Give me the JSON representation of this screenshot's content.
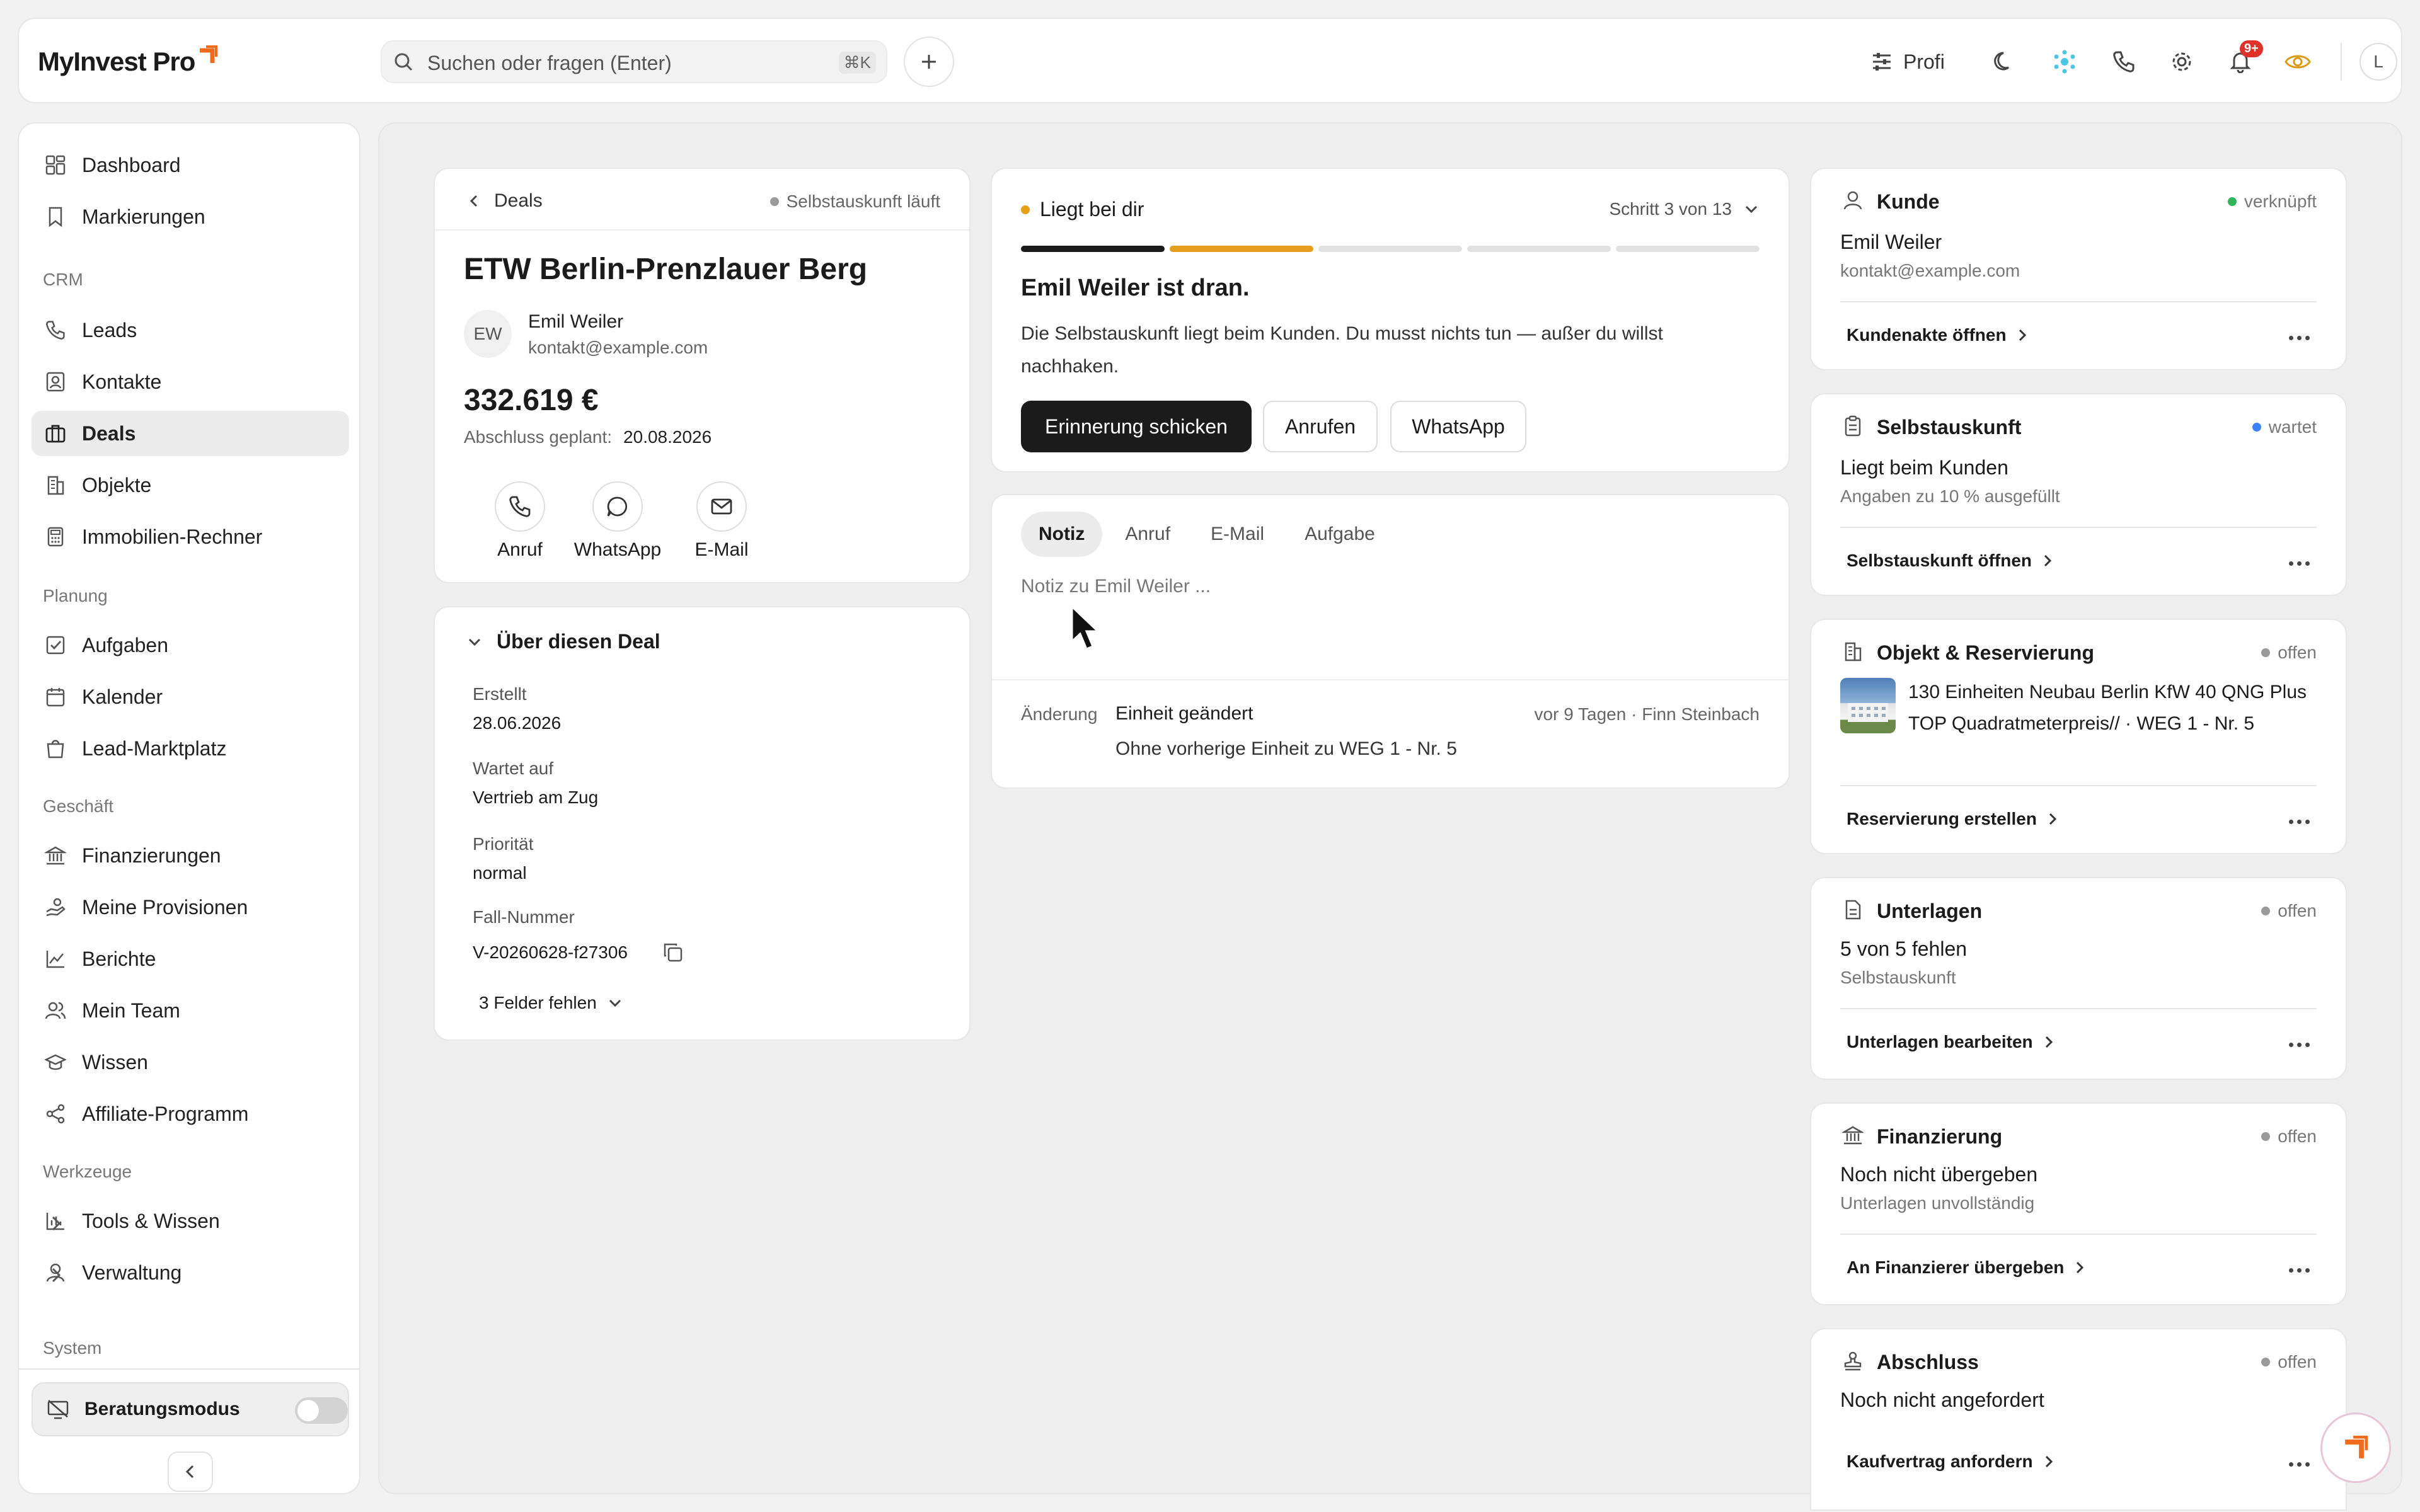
{
  "app": {
    "logo": "MyInvest Pro"
  },
  "search": {
    "placeholder": "Suchen oder fragen (Enter)",
    "shortcut": "⌘K"
  },
  "topbar": {
    "mode_label": "Profi",
    "notification_badge": "9+",
    "avatar_initial": "L"
  },
  "sidebar": {
    "items_main": [
      {
        "label": "Dashboard"
      },
      {
        "label": "Markierungen"
      }
    ],
    "section_crm": "CRM",
    "items_crm": [
      {
        "label": "Leads"
      },
      {
        "label": "Kontakte"
      },
      {
        "label": "Deals"
      },
      {
        "label": "Objekte"
      },
      {
        "label": "Immobilien-Rechner"
      }
    ],
    "section_planung": "Planung",
    "items_planung": [
      {
        "label": "Aufgaben"
      },
      {
        "label": "Kalender"
      },
      {
        "label": "Lead-Marktplatz"
      }
    ],
    "section_geschaeft": "Geschäft",
    "items_geschaeft": [
      {
        "label": "Finanzierungen"
      },
      {
        "label": "Meine Provisionen"
      },
      {
        "label": "Berichte"
      },
      {
        "label": "Mein Team"
      },
      {
        "label": "Wissen"
      },
      {
        "label": "Affiliate-Programm"
      }
    ],
    "section_werkzeuge": "Werkzeuge",
    "items_werkzeuge": [
      {
        "label": "Tools & Wissen"
      },
      {
        "label": "Verwaltung"
      }
    ],
    "section_system": "System",
    "beratungsmodus": "Beratungsmodus"
  },
  "deal": {
    "back_label": "Deals",
    "status": "Selbstauskunft läuft",
    "title": "ETW Berlin-Prenzlauer Berg",
    "contact_initials": "EW",
    "contact_name": "Emil Weiler",
    "contact_email": "kontakt@example.com",
    "amount": "332.619 €",
    "closing_label": "Abschluss geplant:",
    "closing_date": "20.08.2026",
    "actions": [
      {
        "label": "Anruf"
      },
      {
        "label": "WhatsApp"
      },
      {
        "label": "E-Mail"
      }
    ]
  },
  "about": {
    "title": "Über diesen Deal",
    "fields": [
      {
        "label": "Erstellt",
        "value": "28.06.2026"
      },
      {
        "label": "Wartet auf",
        "value": "Vertrieb am Zug"
      },
      {
        "label": "Priorität",
        "value": "normal"
      },
      {
        "label": "Fall-Nummer",
        "value": "V-20260628-f27306"
      }
    ],
    "missing_fields": "3 Felder fehlen"
  },
  "progress": {
    "owner_label": "Liegt bei dir",
    "step_label": "Schritt 3 von 13",
    "headline": "Emil Weiler ist dran.",
    "text": "Die Selbstauskunft liegt beim Kunden. Du musst nichts tun — außer du willst nachhaken.",
    "primary_button": "Erinnerung schicken",
    "call_button": "Anrufen",
    "whatsapp_button": "WhatsApp",
    "segments_done": 1,
    "segments_active": 1,
    "segments_total": 5,
    "colors": {
      "done": "#1b1b1b",
      "active": "#e69f1c",
      "pending": "#e2e2e2"
    }
  },
  "note": {
    "tabs": [
      {
        "label": "Notiz"
      },
      {
        "label": "Anruf"
      },
      {
        "label": "E-Mail"
      },
      {
        "label": "Aufgabe"
      }
    ],
    "placeholder": "Notiz zu Emil Weiler ...",
    "activity": {
      "type": "Änderung",
      "title": "Einheit geändert",
      "detail": "Ohne vorherige Einheit zu WEG 1 - Nr. 5",
      "meta": "vor 9 Tagen · Finn Steinbach"
    }
  },
  "cards": {
    "kunde": {
      "title": "Kunde",
      "status": "verknüpft",
      "line1": "Emil Weiler",
      "line2": "kontakt@example.com",
      "action": "Kundenakte öffnen"
    },
    "selbstauskunft": {
      "title": "Selbstauskunft",
      "status": "wartet",
      "line1": "Liegt beim Kunden",
      "line2": "Angaben zu 10 % ausgefüllt",
      "action": "Selbstauskunft öffnen"
    },
    "objekt": {
      "title": "Objekt & Reservierung",
      "status": "offen",
      "line1": "130 Einheiten Neubau Berlin KfW 40 QNG Plus TOP Quadratmeterpreis// · WEG 1 - Nr. 5",
      "action": "Reservierung erstellen"
    },
    "unterlagen": {
      "title": "Unterlagen",
      "status": "offen",
      "line1": "5 von 5 fehlen",
      "line2": "Selbstauskunft",
      "action": "Unterlagen bearbeiten"
    },
    "finanzierung": {
      "title": "Finanzierung",
      "status": "offen",
      "line1": "Noch nicht übergeben",
      "line2": "Unterlagen unvollständig",
      "action": "An Finanzierer übergeben"
    },
    "abschluss": {
      "title": "Abschluss",
      "status": "offen",
      "line1": "Noch nicht angefordert",
      "action": "Kaufvertrag anfordern"
    }
  },
  "colors": {
    "accent": "#f26b1d",
    "status_green": "#2fb65a",
    "status_blue": "#3b82f6",
    "status_gray": "#9a9a9a"
  }
}
